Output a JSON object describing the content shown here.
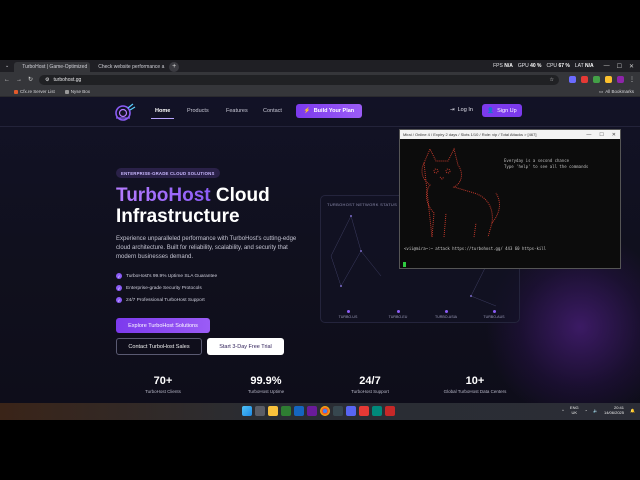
{
  "browser": {
    "tabs": [
      {
        "title": "TurboHost | Game-Optimized",
        "active": true
      },
      {
        "title": "Check website performance a",
        "active": false
      }
    ],
    "stats": [
      {
        "label": "FPS",
        "value": "N/A"
      },
      {
        "label": "GPU",
        "value": "40 %"
      },
      {
        "label": "CPU",
        "value": "67 %"
      },
      {
        "label": "LAT",
        "value": "N/A"
      }
    ],
    "url": "turbohost.gg",
    "bookmarks": [
      "Cfx.re Server List",
      "Nyse Box"
    ],
    "all_bookmarks": "All Bookmarks"
  },
  "nav": {
    "links": [
      "Home",
      "Products",
      "Features",
      "Contact"
    ],
    "plan_button": "Build Your Plan",
    "login": "Log In",
    "signup": "Sign Up"
  },
  "hero": {
    "badge": "ENTERPRISE-GRADE CLOUD SOLUTIONS",
    "title_accent": "TurboHost",
    "title_rest1": "Cloud",
    "title_rest2": "Infrastructure",
    "subtitle": "Experience unparalleled performance with TurboHost's cutting-edge cloud architecture. Built for reliability, scalability, and security that modern businesses demand.",
    "features": [
      "TurboHost's 99.9% Uptime SLA Guarantee",
      "Enterprise-grade Security Protocols",
      "24/7 Professional TurboHost Support"
    ],
    "btn_explore": "Explore TurboHost Solutions",
    "btn_contact": "Contact TurboHost Sales",
    "btn_trial": "Start 3-Day Free Trial"
  },
  "network": {
    "label": "TURBOHOST NETWORK STATUS",
    "nodes": [
      "TURBO-US",
      "TURBO-EU",
      "TURBO-ASIA",
      "TURBO-AUS"
    ]
  },
  "stats": [
    {
      "num": "70+",
      "cap": "TurboHost Clients"
    },
    {
      "num": "99.9%",
      "cap": "TurboHost Uptime"
    },
    {
      "num": "24/7",
      "cap": "TurboHost Support"
    },
    {
      "num": "10+",
      "cap": "Global TurboHost Data Centers"
    }
  ],
  "terminal": {
    "title": "Mirai / Online 4 / Expiry 2 days / Slots 1/10 / Role: vip / Total Attacks > [467]",
    "message_line1": "Everyday is a second chance",
    "message_line2": "Type 'help' to see all the commands",
    "command": "<vii@mira~:~ attack https://turbohost.gg/ 443 60 https-kill"
  },
  "taskbar": {
    "lang1": "ENG",
    "lang2": "UK",
    "time": "20:41",
    "date": "14/06/2025"
  }
}
